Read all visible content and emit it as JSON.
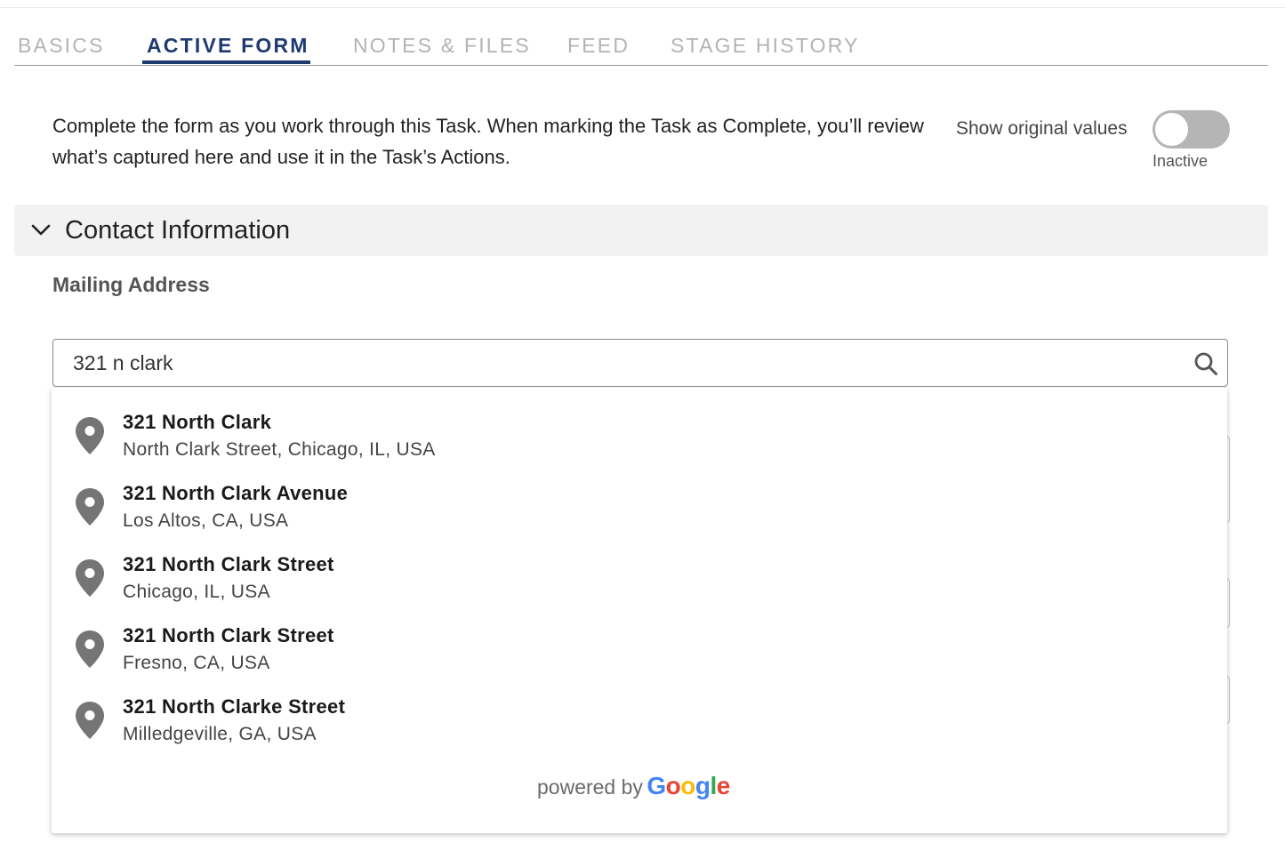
{
  "tabs": [
    {
      "label": "BASICS"
    },
    {
      "label": "ACTIVE FORM"
    },
    {
      "label": "NOTES & FILES"
    },
    {
      "label": "FEED"
    },
    {
      "label": "STAGE HISTORY"
    }
  ],
  "active_tab": "ACTIVE FORM",
  "intro_text": "Complete the form as you work through this Task. When marking the Task as Complete, you’ll review what’s captured here and use it in the Task’s Actions.",
  "toggle": {
    "label": "Show original values",
    "state_text": "Inactive",
    "checked": false
  },
  "section": {
    "title": "Contact Information",
    "expanded": true,
    "icon": "chevron-down-icon"
  },
  "field": {
    "label": "Mailing Address",
    "value": "321 n clark",
    "icon": "search-icon"
  },
  "suggestions": [
    {
      "main": "321 North Clark",
      "secondary": "North Clark Street, Chicago, IL, USA"
    },
    {
      "main": "321 North Clark Avenue",
      "secondary": "Los Altos, CA, USA"
    },
    {
      "main": "321 North Clark Street",
      "secondary": "Chicago, IL, USA"
    },
    {
      "main": "321 North Clark Street",
      "secondary": "Fresno, CA, USA"
    },
    {
      "main": "321 North Clarke Street",
      "secondary": "Milledgeville, GA, USA"
    }
  ],
  "powered_by": {
    "text": "powered by",
    "brand": "Google"
  },
  "colors": {
    "accent": "#1e3a6e",
    "pin": "#757575",
    "google_blue": "#4285F4",
    "google_red": "#EA4335",
    "google_yellow": "#FBBC05",
    "google_green": "#34A853"
  }
}
